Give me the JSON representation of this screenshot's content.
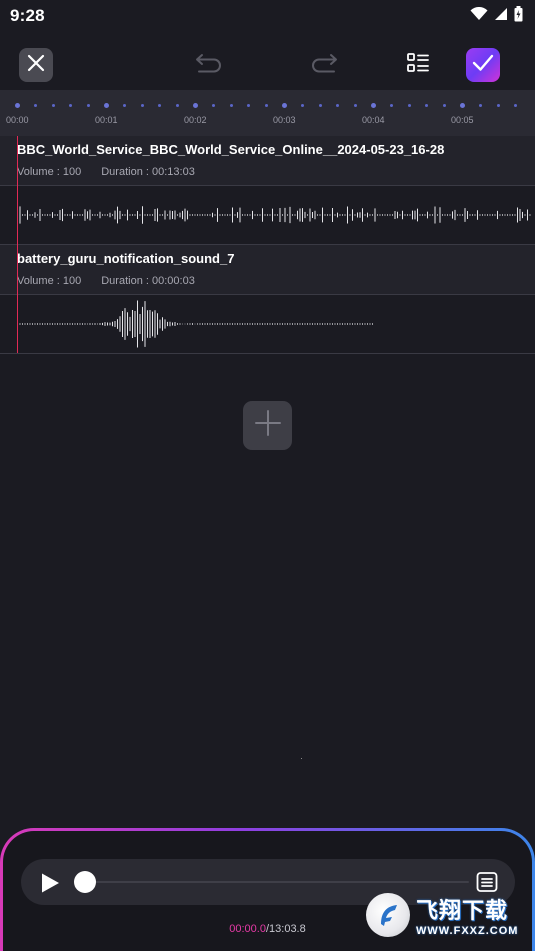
{
  "status": {
    "time": "9:28",
    "icons": [
      "wifi-icon",
      "signal-icon",
      "battery-icon"
    ]
  },
  "toolbar": {
    "close_icon": "close-icon",
    "undo_icon": "undo-icon",
    "redo_icon": "redo-icon",
    "list_icon": "list-icon",
    "confirm_icon": "check-icon"
  },
  "timeline": {
    "labels": [
      "00:00",
      "00:01",
      "00:02",
      "00:03",
      "00:04",
      "00:05"
    ]
  },
  "tracks": [
    {
      "name": "BBC_World_Service_BBC_World_Service_Online__2024-05-23_16-28",
      "volume_label": "Volume :",
      "volume": "100",
      "duration_label": "Duration :",
      "duration": "00:13:03"
    },
    {
      "name": "battery_guru_notification_sound_7",
      "volume_label": "Volume :",
      "volume": "100",
      "duration_label": "Duration :",
      "duration": "00:00:03"
    }
  ],
  "add_button": {
    "icon": "plus-icon"
  },
  "player": {
    "current_time": "00:00.0",
    "separator": "/",
    "total_time": "13:03.8",
    "progress": 0
  },
  "watermark": {
    "title": "飞翔下载",
    "url": "WWW.FXXZ.COM"
  },
  "colors": {
    "background": "#1b1b22",
    "playhead": "#e02a55",
    "accent_pink": "#e73aa7",
    "accent_blue": "#3d86ea",
    "ruler_dot": "#5b66c7"
  }
}
